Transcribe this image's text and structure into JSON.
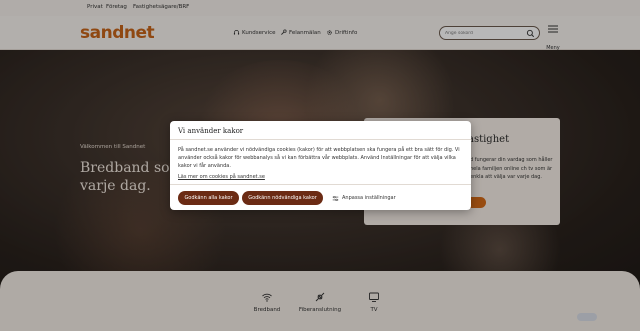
{
  "topbar": {
    "links": [
      "Privat",
      "Företag",
      "Fastighetsägare/BRF"
    ]
  },
  "header": {
    "logo": "sandnet",
    "nav": [
      {
        "label": "Kundservice",
        "icon": "headset-icon"
      },
      {
        "label": "Felanmälan",
        "icon": "wrench-icon"
      },
      {
        "label": "Driftinfo",
        "icon": "gear-icon"
      }
    ],
    "search_placeholder": "Ange sökord",
    "menu_label": "Meny"
  },
  "hero": {
    "welcome": "Välkommen till Sandnet",
    "headline_line1": "Bredband som",
    "headline_line2": "varje dag."
  },
  "card": {
    "title": "astighet",
    "text": "d fungerar din vardag som håller hela familjen online ch tv som är enkla att välja var varje dag."
  },
  "services": [
    {
      "label": "Bredband",
      "icon": "wifi-icon"
    },
    {
      "label": "Fiberanslutning",
      "icon": "fiber-plug-icon"
    },
    {
      "label": "TV",
      "icon": "tv-icon"
    }
  ],
  "cookie_modal": {
    "title": "Vi använder kakor",
    "body": "På sandnet.se använder vi nödvändiga cookies (kakor) för att webbplatsen ska fungera på ett bra sätt för dig. Vi använder också kakor för webbanalys så vi kan förbättra vår webbplats. Använd Inställningar för att välja vilka kakor vi får använda.",
    "link": "Läs mer om cookies på sandnet.se",
    "accept_all": "Godkänn alla kakor",
    "accept_necessary": "Godkänn nödvändiga kakor",
    "customize": "Anpassa inställningar"
  },
  "colors": {
    "brand": "#c7651a",
    "button": "#6b2b14"
  }
}
